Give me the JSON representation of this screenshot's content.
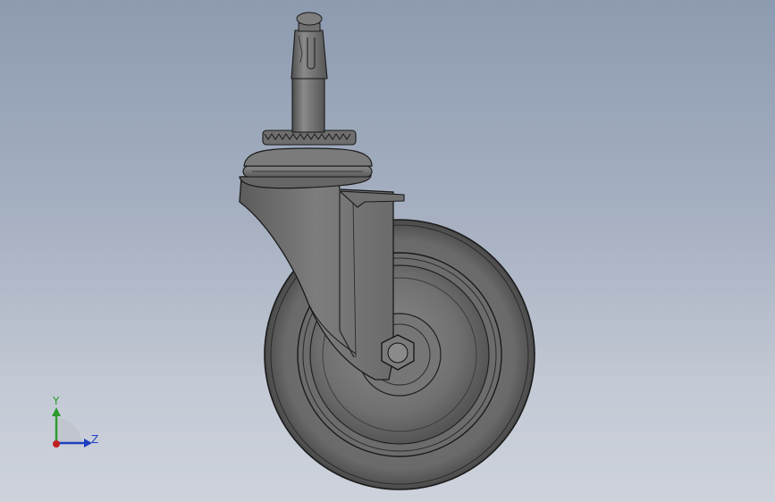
{
  "scene": {
    "model": "caster-wheel-assembly",
    "background_top": "#8d9bb0",
    "background_bottom": "#cdd2dc",
    "part_color": "#6e6e6e",
    "edge_color": "#1a1a1a"
  },
  "triad": {
    "y_label": "Y",
    "z_label": "Z",
    "y_color": "#2c9a2c",
    "z_color": "#1f3fc0",
    "x_color": "#c01f1f"
  }
}
